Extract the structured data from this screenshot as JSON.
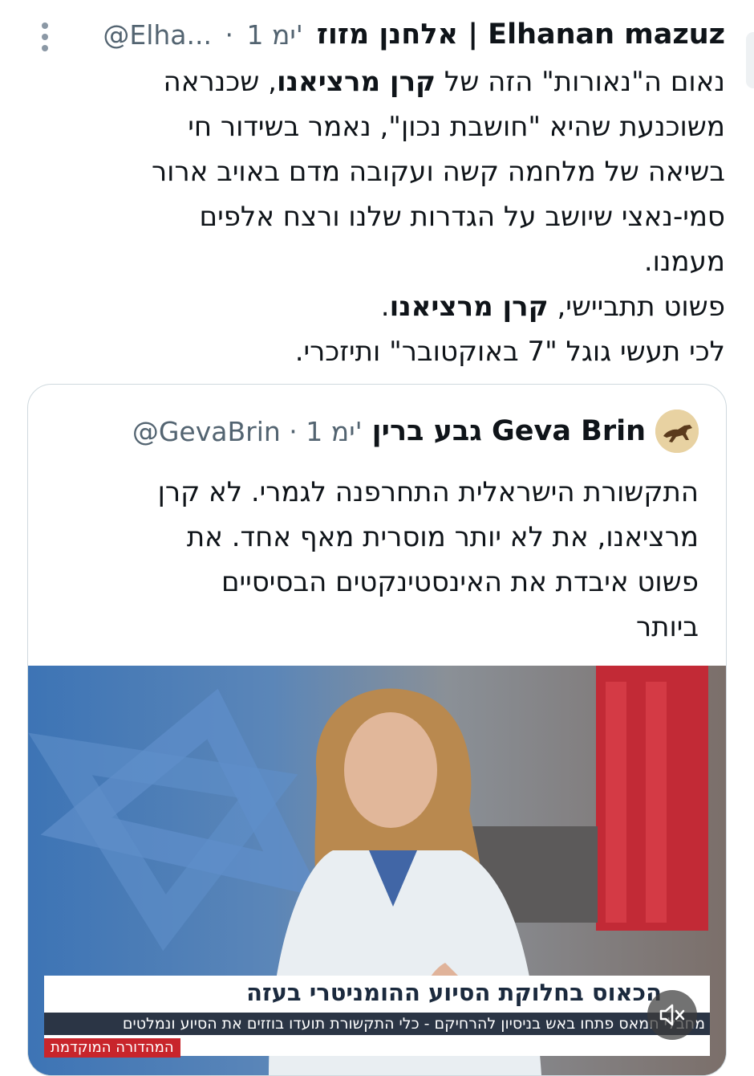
{
  "tweet": {
    "author_name": "אלחנן מזוז | Elhanan mazuz",
    "handle": "@Elha...",
    "separator": "·",
    "time": "1 ימ'",
    "body_lines": [
      {
        "pre": "נאום ה\"נאורות\" הזה של ",
        "bold": "קרן מרציאנו",
        "post": ", שכנראה"
      },
      {
        "pre": "משוכנעת שהיא \"חושבת נכון\", נאמר בשידור חי",
        "bold": "",
        "post": ""
      },
      {
        "pre": "בשיאה של מלחמה קשה ועקובה מדם באויב ארור",
        "bold": "",
        "post": ""
      },
      {
        "pre": "סמי-נאצי שיושב על הגדרות שלנו ורצח אלפים",
        "bold": "",
        "post": ""
      },
      {
        "pre": "מעמנו.",
        "bold": "",
        "post": ""
      },
      {
        "pre": "פשוט תתביישי, ",
        "bold": "קרן מרציאנו",
        "post": "."
      },
      {
        "pre": "לכי תעשי גוגל \"7 באוקטובר\" ותיזכרי.",
        "bold": "",
        "post": ""
      }
    ]
  },
  "quote": {
    "author_name": "גבע ברין Geva Brin",
    "handle": "@GevaBrin",
    "separator": "·",
    "time": "1 ימ'",
    "text_lines": [
      "התקשורת הישראלית התחרפנה לגמרי. לא קרן",
      "מרציאנו, את לא יותר מוסרית מאף אחד. את",
      "פשוט איבדת את האינסטינקטים הבסיסיים",
      "ביותר"
    ],
    "video": {
      "headline": "הכאוס בחלוקת הסיוע ההומניטרי בעזה",
      "subline": "מחבלי חמאס פתחו באש בניסיון להרחיקם - כלי התקשורת תועדו בוזזים את הסיוע ונמלטים",
      "tag": "המהדורה המוקדמת",
      "muted_icon": "speaker-muted-icon"
    }
  }
}
